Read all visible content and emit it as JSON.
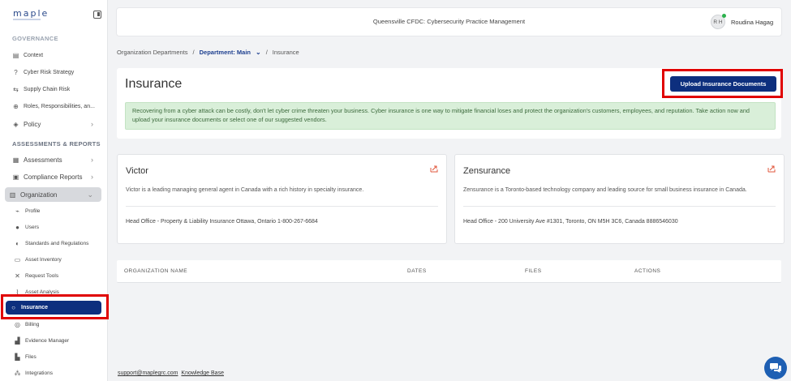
{
  "app": {
    "logo": "maple"
  },
  "sidebar": {
    "governance_title": "GOVERNANCE",
    "governance_items": [
      {
        "label": "Context",
        "icon": "document-icon"
      },
      {
        "label": "Cyber Risk Strategy",
        "icon": "strategy-icon"
      },
      {
        "label": "Supply Chain Risk",
        "icon": "supply-chain-icon"
      },
      {
        "label": "Roles, Responsibilities, an...",
        "icon": "roles-icon"
      },
      {
        "label": "Policy",
        "icon": "shield-icon"
      }
    ],
    "assess_title": "ASSESSMENTS & REPORTS",
    "assess_items": [
      {
        "label": "Assessments",
        "icon": "assessment-icon"
      },
      {
        "label": "Compliance Reports",
        "icon": "report-icon"
      },
      {
        "label": "Organization",
        "icon": "organization-icon"
      }
    ],
    "org_items": [
      {
        "label": "Profile"
      },
      {
        "label": "Users"
      },
      {
        "label": "Standards and Regulations"
      },
      {
        "label": "Asset Inventory"
      },
      {
        "label": "Request Tools"
      },
      {
        "label": "Asset Analysis"
      },
      {
        "label": "Insurance"
      },
      {
        "label": "Billing"
      },
      {
        "label": "Evidence Manager"
      },
      {
        "label": "Files"
      },
      {
        "label": "Integrations"
      }
    ]
  },
  "header": {
    "title": "Queensville CFDC: Cybersecurity Practice Management",
    "user_initials": "R H",
    "user_name": "Roudina Hagag"
  },
  "breadcrumb": {
    "root": "Organization Departments",
    "department": "Department: Main",
    "current": "Insurance"
  },
  "insurance": {
    "title": "Insurance",
    "upload_label": "Upload Insurance Documents",
    "notice": "Recovering from a cyber attack can be costly, don't let cyber crime threaten your business. Cyber insurance is one way to mitigate financial loses and protect the organization's customers, employees, and reputation. Take action now and upload your insurance documents or select one of our suggested vendors."
  },
  "vendors": [
    {
      "name": "Victor",
      "description": "Victor is a leading managing general agent in Canada with a rich history in specialty insurance.",
      "office": "Head Office - Property & Liability Insurance Ottawa, Ontario 1-800-267-6684"
    },
    {
      "name": "Zensurance",
      "description": "Zensurance is a Toronto-based technology company and leading source for small business insurance in Canada.",
      "office": "Head Office - 200 University Ave #1301, Toronto, ON M5H 3C6, Canada 8886546030"
    }
  ],
  "table": {
    "columns": [
      "ORGANIZATION NAME",
      "DATES",
      "FILES",
      "ACTIONS"
    ]
  },
  "footer": {
    "email": "support@maplegrc.com",
    "kb": "Knowledge Base"
  },
  "colors": {
    "primary": "#0d2f7e",
    "notice_bg": "#d9efd9",
    "highlight": "#e00000"
  }
}
